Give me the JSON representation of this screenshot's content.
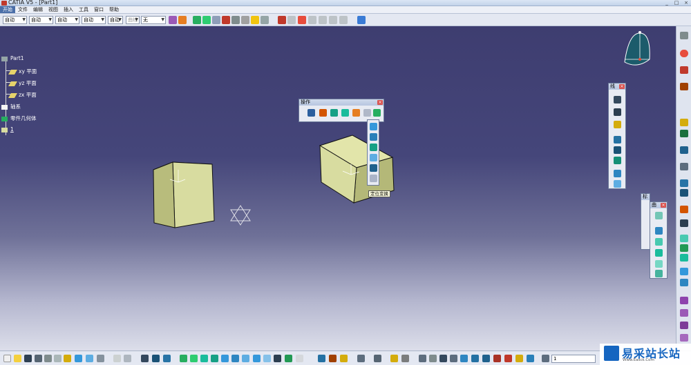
{
  "window": {
    "title": "CATIA V5 - [Part1]"
  },
  "menu": [
    "开始",
    "文件",
    "编辑",
    "视图",
    "插入",
    "工具",
    "窗口",
    "帮助"
  ],
  "toolbar": {
    "selects": [
      {
        "value": "自动",
        "disabled": false
      },
      {
        "value": "自动",
        "disabled": false
      },
      {
        "value": "自动",
        "disabled": false
      },
      {
        "value": "自动",
        "disabled": false
      },
      {
        "value": "自动",
        "disabled": false
      },
      {
        "value": "自动",
        "disabled": false
      },
      {
        "value": "曲线",
        "disabled": true
      },
      {
        "value": "无",
        "disabled": false
      }
    ]
  },
  "tree": {
    "root": "Part1",
    "items": [
      "xy 平面",
      "yz 平面",
      "zx 平面",
      "轴系",
      "零件几何体",
      "1"
    ]
  },
  "floating_toolbars": {
    "operation": {
      "title": "操作"
    },
    "line": {
      "title": "线"
    },
    "small1": {
      "title": "标"
    },
    "small2": {
      "title": "曲"
    }
  },
  "tooltip": "定位变换",
  "bottom": {
    "command_input": "1"
  },
  "watermark": {
    "text": "易采站长站",
    "subtext": "Www.Easck.Com"
  },
  "colors": {
    "solid_face": "#d8dca0",
    "solid_side": "#b4b878",
    "background_top": "#3e3d70",
    "background_bottom": "#dcdeea"
  }
}
